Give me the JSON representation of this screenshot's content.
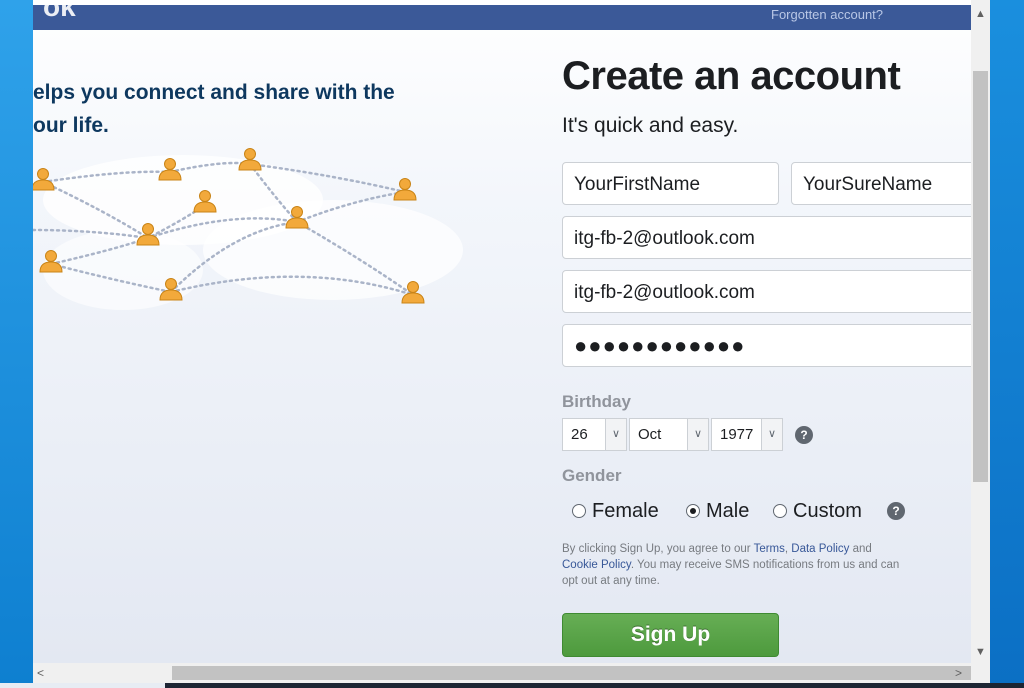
{
  "header": {
    "logo_fragment": "ok",
    "forgotten_account": "Forgotten account?"
  },
  "intro": {
    "tagline_line1": "elps you connect and share with the",
    "tagline_line2": "our life."
  },
  "form": {
    "title": "Create an account",
    "subtitle": "It's quick and easy.",
    "first_name": "YourFirstName",
    "surname": "YourSureName",
    "email": "itg-fb-2@outlook.com",
    "email_confirm": "itg-fb-2@outlook.com",
    "password_mask": "●●●●●●●●●●●●",
    "birthday": {
      "label": "Birthday",
      "day": "26",
      "month": "Oct",
      "year": "1977",
      "help": "?"
    },
    "gender": {
      "label": "Gender",
      "options": [
        "Female",
        "Male",
        "Custom"
      ],
      "selected": "Male",
      "help": "?"
    },
    "terms": {
      "prefix": "By clicking Sign Up, you agree to our ",
      "terms_link": "Terms",
      "separator": ", ",
      "data_policy_link": "Data Policy",
      "and": " and ",
      "cookie_policy_link": "Cookie Policy",
      "suffix": ". You may receive SMS notifications from us and can opt out at any time."
    },
    "signup_label": "Sign Up"
  },
  "scrollbars": {
    "up": "▲",
    "down": "▼",
    "left": "<",
    "right": ">"
  },
  "colors": {
    "brand_blue": "#3b5998",
    "signup_green": "#5aa447",
    "avatar_orange": "#f0a830"
  },
  "icons": {
    "person": "person-icon",
    "help": "help-icon"
  }
}
